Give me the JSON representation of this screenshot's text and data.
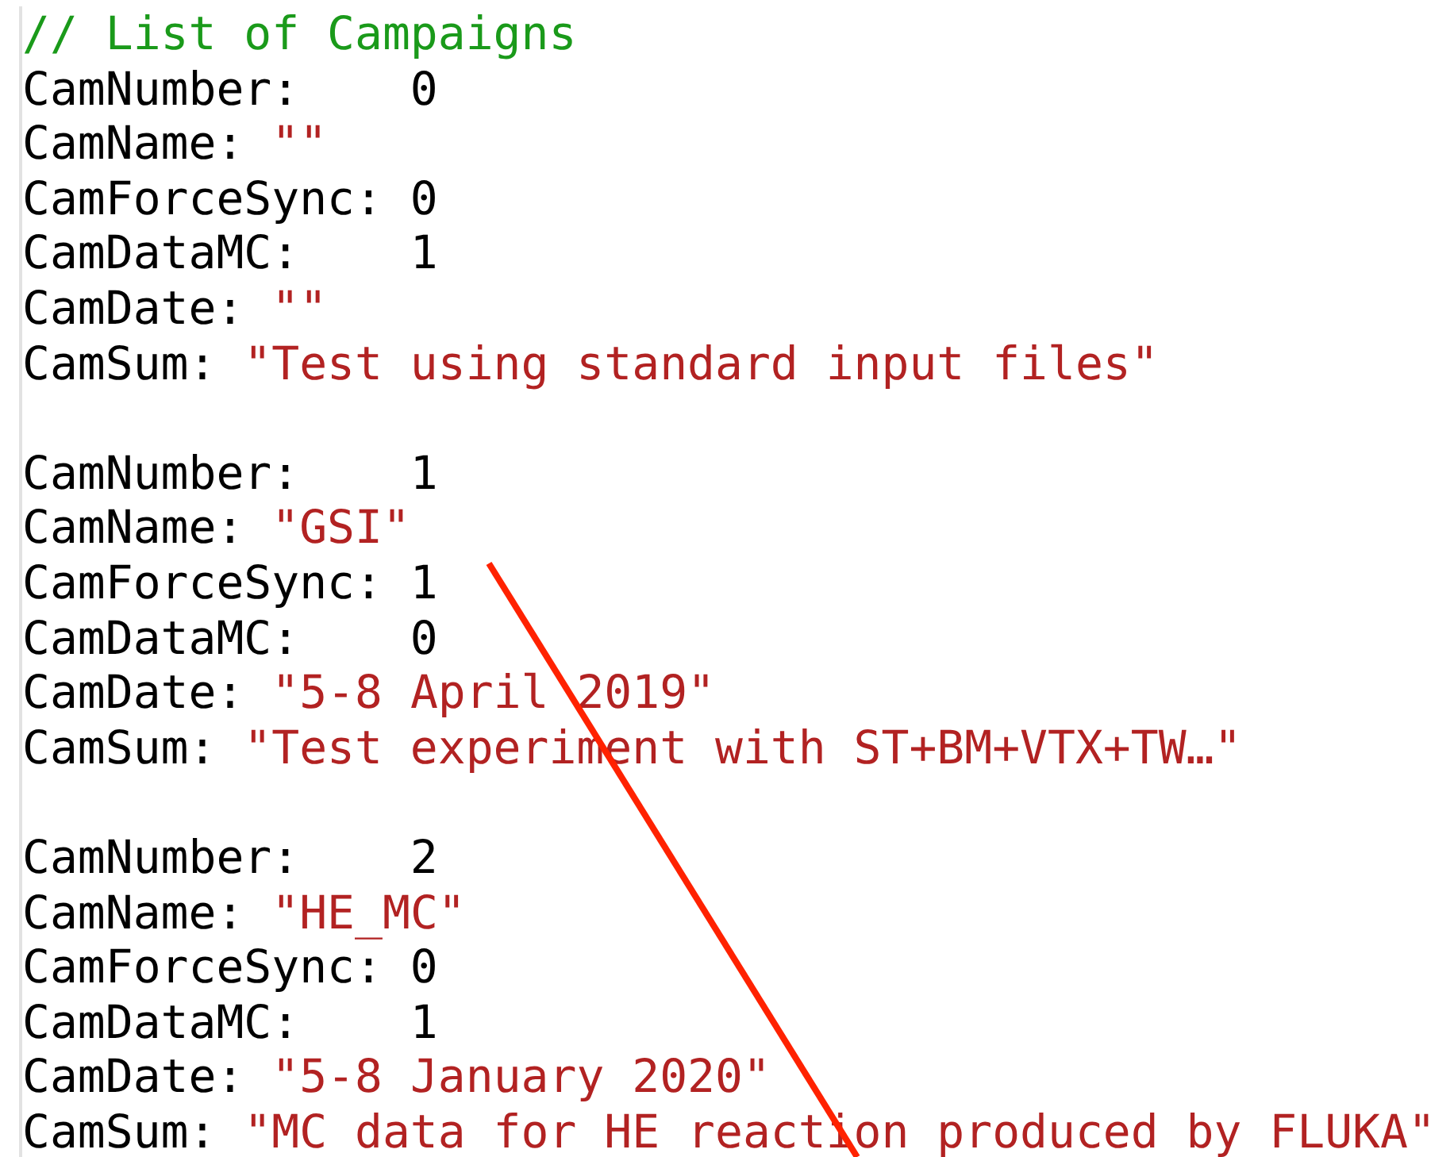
{
  "editor": {
    "lines": [
      {
        "kind": "comment",
        "text": "// List of Campaigns"
      },
      {
        "kind": "number_field",
        "key": "CamNumber:",
        "value": "0"
      },
      {
        "kind": "string_field",
        "key": "CamName:",
        "value": "\"\""
      },
      {
        "kind": "number_field",
        "key": "CamForceSync:",
        "value": "0"
      },
      {
        "kind": "number_field",
        "key": "CamDataMC:",
        "value": "1"
      },
      {
        "kind": "string_field",
        "key": "CamDate:",
        "value": "\"\""
      },
      {
        "kind": "string_field",
        "key": "CamSum:",
        "value": "\"Test using standard input files\""
      },
      {
        "kind": "blank"
      },
      {
        "kind": "number_field",
        "key": "CamNumber:",
        "value": "1"
      },
      {
        "kind": "string_field",
        "key": "CamName:",
        "value": "\"GSI\""
      },
      {
        "kind": "number_field",
        "key": "CamForceSync:",
        "value": "1"
      },
      {
        "kind": "number_field",
        "key": "CamDataMC:",
        "value": "0"
      },
      {
        "kind": "string_field",
        "key": "CamDate:",
        "value": "\"5-8 April 2019\""
      },
      {
        "kind": "string_field",
        "key": "CamSum:",
        "value": "\"Test experiment with ST+BM+VTX+TW…\""
      },
      {
        "kind": "blank"
      },
      {
        "kind": "number_field",
        "key": "CamNumber:",
        "value": "2"
      },
      {
        "kind": "string_field",
        "key": "CamName:",
        "value": "\"HE_MC\""
      },
      {
        "kind": "number_field",
        "key": "CamForceSync:",
        "value": "0"
      },
      {
        "kind": "number_field",
        "key": "CamDataMC:",
        "value": "1"
      },
      {
        "kind": "string_field",
        "key": "CamDate:",
        "value": "\"5-8 January 2020\""
      },
      {
        "kind": "string_field",
        "key": "CamSum:",
        "value": "\"MC data for HE reaction produced by FLUKA\""
      }
    ]
  },
  "annotation": {
    "kind": "line",
    "color": "#ff2200"
  }
}
